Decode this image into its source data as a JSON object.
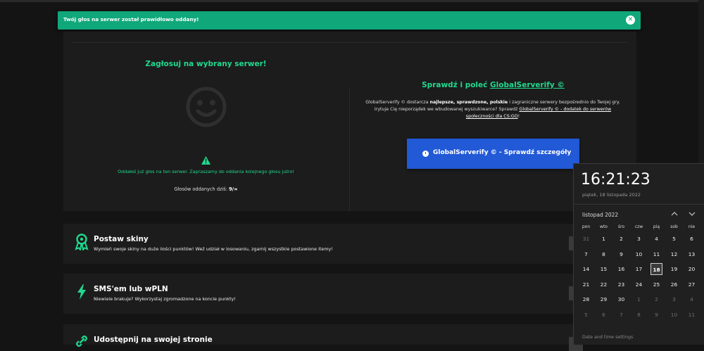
{
  "toast": {
    "message": "Twój głos na serwer został prawidłowo oddany!",
    "close_glyph": "✕"
  },
  "vote": {
    "title": "Zagłosuj na wybrany serwer!",
    "already_voted": "Oddałeś już głos na ten serwer. Zapraszamy do oddania kolejnego głosu jutro!",
    "votes_today_label": "Głosów oddanych dziś:",
    "votes_today_value": "9/∞"
  },
  "check": {
    "title_prefix": "Sprawdź i poleć",
    "title_link": "GlobalServerify ©",
    "desc_1": "GlobalServerify © dostarcza",
    "desc_bold": "najlepsze, sprawdzone, polskie",
    "desc_2": "i zagraniczne serwery bezpośrednio do Twojej gry. Irytuje Cię nieporządek we wbudowanej wyszukiwarce? Sprawdź",
    "desc_link": "GlobalServerify © - dodatek do serwerów społeczności dla CS:GO",
    "desc_end": "!",
    "cta_label": "GlobalServerify © - Sprawdź szczegóły"
  },
  "features": [
    {
      "title": "Postaw skiny",
      "desc": "Wymień swoje skiny na duże ilości punktów! Weź udział w losowaniu, zgarnij wszystkie postawione itemy!",
      "icon": "award-icon"
    },
    {
      "title": "SMS'em lub wPLN",
      "desc": "Niewiele brakuje? Wykorzystaj zgromadzone na koncie punkty!",
      "icon": "lightning-icon"
    },
    {
      "title": "Udostępnij na swojej stronie",
      "desc": "",
      "icon": "link-icon"
    }
  ],
  "calendar": {
    "time": "16:21:23",
    "date_full": "piątek, 18 listopada 2022",
    "month": "listopad 2022",
    "weekdays": [
      "pon",
      "wto",
      "śro",
      "czw",
      "pią",
      "sob",
      "nie"
    ],
    "weeks": [
      [
        "31",
        "1",
        "2",
        "3",
        "4",
        "5",
        "6"
      ],
      [
        "7",
        "8",
        "9",
        "10",
        "11",
        "12",
        "13"
      ],
      [
        "14",
        "15",
        "16",
        "17",
        "18",
        "19",
        "20"
      ],
      [
        "21",
        "22",
        "23",
        "24",
        "25",
        "26",
        "27"
      ],
      [
        "28",
        "29",
        "30",
        "1",
        "2",
        "3",
        "4"
      ],
      [
        "5",
        "6",
        "7",
        "8",
        "9",
        "10",
        "11"
      ]
    ],
    "today": "18",
    "settings_link": "Date and time settings"
  },
  "colors": {
    "accent_green": "#20d98e",
    "toast": "#10a77a",
    "cta_blue": "#2159d6",
    "background": "#141414",
    "card": "#1c1c1c"
  }
}
